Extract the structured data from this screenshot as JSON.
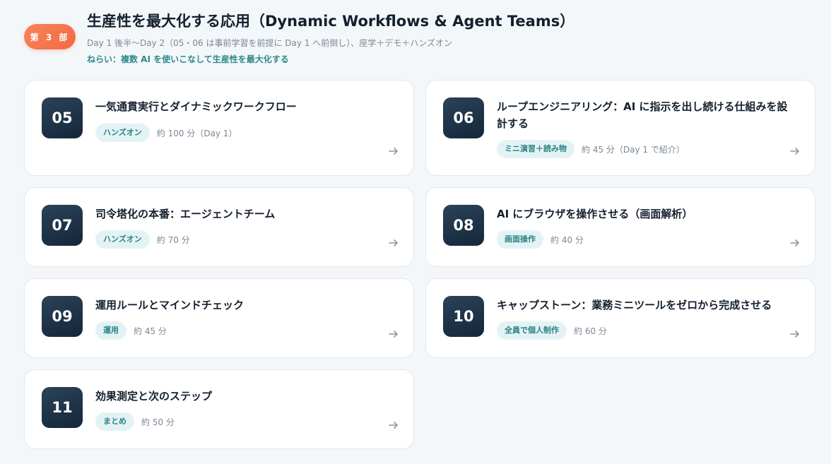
{
  "header": {
    "part_badge": "第 3 部",
    "title": "生産性を最大化する応用（Dynamic Workflows & Agent Teams）",
    "subtitle": "Day 1 後半〜Day 2（05・06 は事前学習を前提に Day 1 へ前倒し）、座学＋デモ＋ハンズオン",
    "aim": "ねらい：複数 AI を使いこなして生産性を最大化する"
  },
  "sessions": [
    {
      "number": "05",
      "title": "一気通貫実行とダイナミックワークフロー",
      "tag": "ハンズオン",
      "duration": "約 100 分（Day 1）"
    },
    {
      "number": "06",
      "title": "ループエンジニアリング：AI に指示を出し続ける仕組みを設計する",
      "tag": "ミニ演習＋読み物",
      "duration": "約 45 分（Day 1 で紹介）"
    },
    {
      "number": "07",
      "title": "司令塔化の本番：エージェントチーム",
      "tag": "ハンズオン",
      "duration": "約 70 分"
    },
    {
      "number": "08",
      "title": "AI にブラウザを操作させる（画面解析）",
      "tag": "画面操作",
      "duration": "約 40 分"
    },
    {
      "number": "09",
      "title": "運用ルールとマインドチェック",
      "tag": "運用",
      "duration": "約 45 分"
    },
    {
      "number": "10",
      "title": "キャップストーン：業務ミニツールをゼロから完成させる",
      "tag": "全員で個人制作",
      "duration": "約 60 分"
    },
    {
      "number": "11",
      "title": "効果測定と次のステップ",
      "tag": "まとめ",
      "duration": "約 50 分"
    }
  ],
  "icons": {
    "arrow": "arrow-right-icon"
  },
  "colors": {
    "accent": "#f26a45",
    "tag_bg": "#e3f3f5",
    "tag_text": "#2a8284",
    "number_bg": "#1c3045"
  }
}
